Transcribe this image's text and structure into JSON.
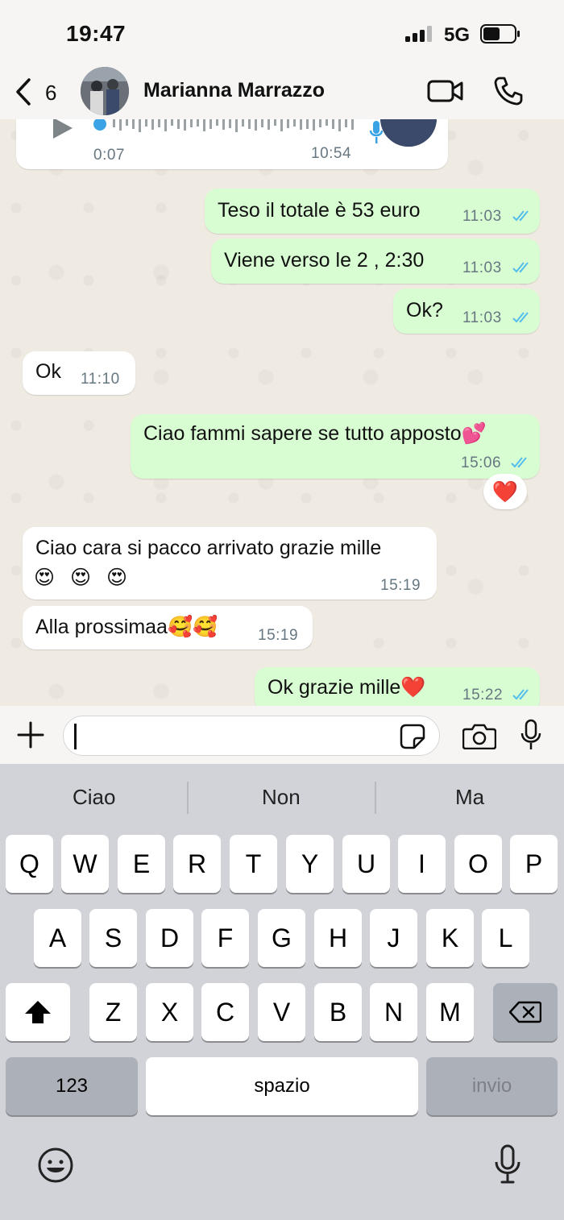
{
  "status_bar": {
    "time": "19:47",
    "network": "5G"
  },
  "header": {
    "back_count": "6",
    "contact_name": "Marianna Marrazzo"
  },
  "voice_message": {
    "duration": "0:07",
    "time": "10:54"
  },
  "messages": [
    {
      "direction": "out",
      "text": "Teso il totale è 53 euro",
      "time": "11:03"
    },
    {
      "direction": "out",
      "text": "Viene verso le 2 , 2:30",
      "time": "11:03"
    },
    {
      "direction": "out",
      "text": "Ok?",
      "time": "11:03"
    },
    {
      "direction": "in",
      "text": "Ok",
      "time": "11:10"
    },
    {
      "direction": "out",
      "text": "Ciao fammi sapere se tutto apposto💕",
      "time": "15:06",
      "reaction": "❤️"
    },
    {
      "direction": "in",
      "text": "Ciao cara si pacco arrivato grazie mille",
      "text2": "😍 😍 😍",
      "time": "15:19"
    },
    {
      "direction": "in",
      "text": "Alla prossimaa🥰🥰",
      "time": "15:19"
    },
    {
      "direction": "out",
      "text": "Ok grazie mille❤️",
      "time": "15:22"
    }
  ],
  "input": {
    "value": ""
  },
  "keyboard": {
    "suggestions": [
      "Ciao",
      "Non",
      "Ma"
    ],
    "row1": [
      "Q",
      "W",
      "E",
      "R",
      "T",
      "Y",
      "U",
      "I",
      "O",
      "P"
    ],
    "row2": [
      "A",
      "S",
      "D",
      "F",
      "G",
      "H",
      "J",
      "K",
      "L"
    ],
    "row3": [
      "Z",
      "X",
      "C",
      "V",
      "B",
      "N",
      "M"
    ],
    "numbers_key": "123",
    "space_key": "spazio",
    "return_key": "invio"
  },
  "colors": {
    "outgoing_bubble": "#d9fdd3",
    "incoming_bubble": "#ffffff",
    "read_ticks": "#53bdeb",
    "chat_background": "#efeae2"
  }
}
